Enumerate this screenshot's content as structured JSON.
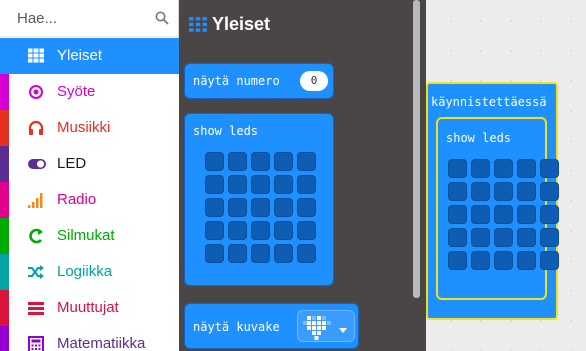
{
  "search": {
    "placeholder": "Hae..."
  },
  "categories": [
    {
      "label": "Yleiset",
      "color": "#1e90ff",
      "icon": "grid-icon",
      "selected": true
    },
    {
      "label": "Syöte",
      "color": "#d400d4",
      "icon": "target-icon"
    },
    {
      "label": "Musiikki",
      "color": "#e63022",
      "icon": "headphones-icon"
    },
    {
      "label": "LED",
      "color": "#5c2d91",
      "icon": "toggle-icon"
    },
    {
      "label": "Radio",
      "color": "#e3008c",
      "icon": "signal-bars-icon"
    },
    {
      "label": "Silmukat",
      "color": "#00aa00",
      "icon": "loop-arrow-icon"
    },
    {
      "label": "Logiikka",
      "color": "#00a4a6",
      "icon": "shuffle-icon"
    },
    {
      "label": "Muuttujat",
      "color": "#dc143c",
      "icon": "lines-icon"
    },
    {
      "label": "Matematiikka",
      "color": "#9400d3",
      "icon": "calculator-icon"
    }
  ],
  "flyout": {
    "title": "Yleiset",
    "blocks": {
      "show_number": {
        "label": "näytä numero",
        "value": "0"
      },
      "show_leds": {
        "label": "show leds"
      },
      "show_icon": {
        "label": "näytä kuvake",
        "icon": "heart-icon"
      }
    }
  },
  "workspace": {
    "on_start": {
      "label": "käynnistettäessä"
    },
    "show_leds": {
      "label": "show leds"
    }
  },
  "colors": {
    "block": "#1e90ff",
    "flyout_bg": "#4b4646",
    "hat_outline": "#f2e018"
  }
}
